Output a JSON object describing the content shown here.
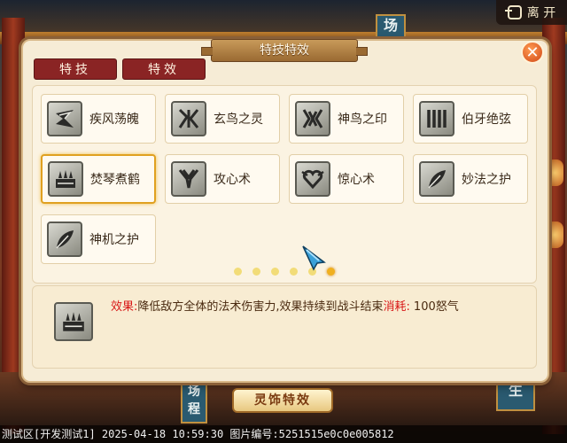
{
  "header": {
    "leave_label": "离 开",
    "leave_icon": "exit-icon"
  },
  "background": {
    "sign_left_top": "场",
    "sign_left_bottom": "场程",
    "sign_right": "生"
  },
  "dialog": {
    "title": "特技特效",
    "close_icon": "close-icon",
    "tabs": [
      {
        "label": "特技"
      },
      {
        "label": "特效"
      }
    ],
    "skills": [
      {
        "name": "疾风荡魄",
        "icon": "wind-rune-icon"
      },
      {
        "name": "玄鸟之灵",
        "icon": "bird-rune-icon"
      },
      {
        "name": "神鸟之印",
        "icon": "phoenix-rune-icon"
      },
      {
        "name": "伯牙绝弦",
        "icon": "zither-rune-icon"
      },
      {
        "name": "焚琴煮鹤",
        "icon": "zither-fire-icon",
        "selected": true
      },
      {
        "name": "攻心术",
        "icon": "heart-attack-icon"
      },
      {
        "name": "惊心术",
        "icon": "heart-rune-icon"
      },
      {
        "name": "妙法之护",
        "icon": "feather-icon"
      },
      {
        "name": "神机之护",
        "icon": "feather-icon"
      }
    ],
    "pagination": {
      "pages": 6,
      "current": 6
    },
    "description": {
      "effect_label": "效果:",
      "effect_text": "降低敌方全体的法术伤害力,效果持续到战斗结束",
      "cost_label": "消耗:",
      "cost_value": "100怒气"
    }
  },
  "spirit_button": {
    "label": "灵饰特效"
  },
  "status_bar": {
    "text": "测试区[开发测试1] 2025-04-18 10:59:30 图片编号:5251515e0c0e005812"
  }
}
